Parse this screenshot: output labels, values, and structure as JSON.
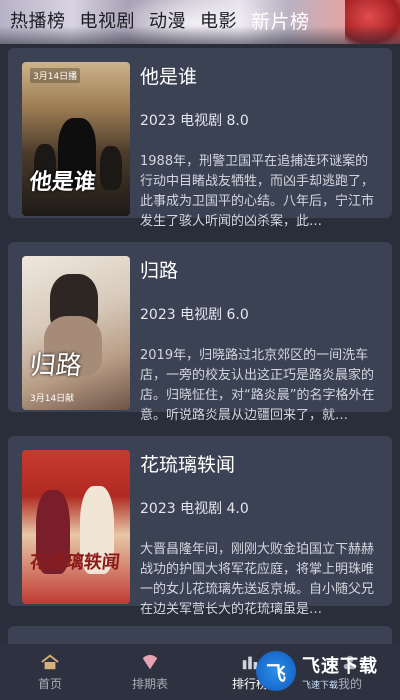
{
  "tabs": [
    "热播榜",
    "电视剧",
    "动漫",
    "电影",
    "新片榜"
  ],
  "active_tab": 4,
  "items": [
    {
      "title": "他是谁",
      "meta": "2023 电视剧 8.0",
      "desc": "1988年，刑警卫国平在追捕连环谜案的行动中目睹战友牺牲，而凶手却逃跑了，此事成为卫国平的心结。八年后，宁江市发生了骇人听闻的凶杀案，此…",
      "poster_title": "他是谁",
      "poster_top": "3月14日播"
    },
    {
      "title": "归路",
      "meta": "2023 电视剧 6.0",
      "desc": "2019年，归晓路过北京郊区的一间洗车店，一旁的校友认出这正巧是路炎晨家的店。归晓怔住，对“路炎晨”的名字格外在意。听说路炎晨从边疆回来了，就…",
      "poster_title": "归路",
      "poster_date": "3月14日献"
    },
    {
      "title": "花琉璃轶闻",
      "meta": "2023 电视剧 4.0",
      "desc": "大晋昌隆年间，刚刚大败金珀国立下赫赫战功的护国大将军花应庭，将掌上明珠唯一的女儿花琉璃先送返京城。自小随父兄在边关军营长大的花琉璃虽是…",
      "poster_title": "花琉璃轶闻"
    }
  ],
  "nav": [
    {
      "label": "首页",
      "icon": "home-icon"
    },
    {
      "label": "排期表",
      "icon": "schedule-icon"
    },
    {
      "label": "排行榜",
      "icon": "ranking-icon"
    },
    {
      "label": "我的",
      "icon": "profile-icon"
    }
  ],
  "watermark": {
    "logo_text": "飞",
    "main": "飞速下载",
    "sub": "飞速下载"
  }
}
